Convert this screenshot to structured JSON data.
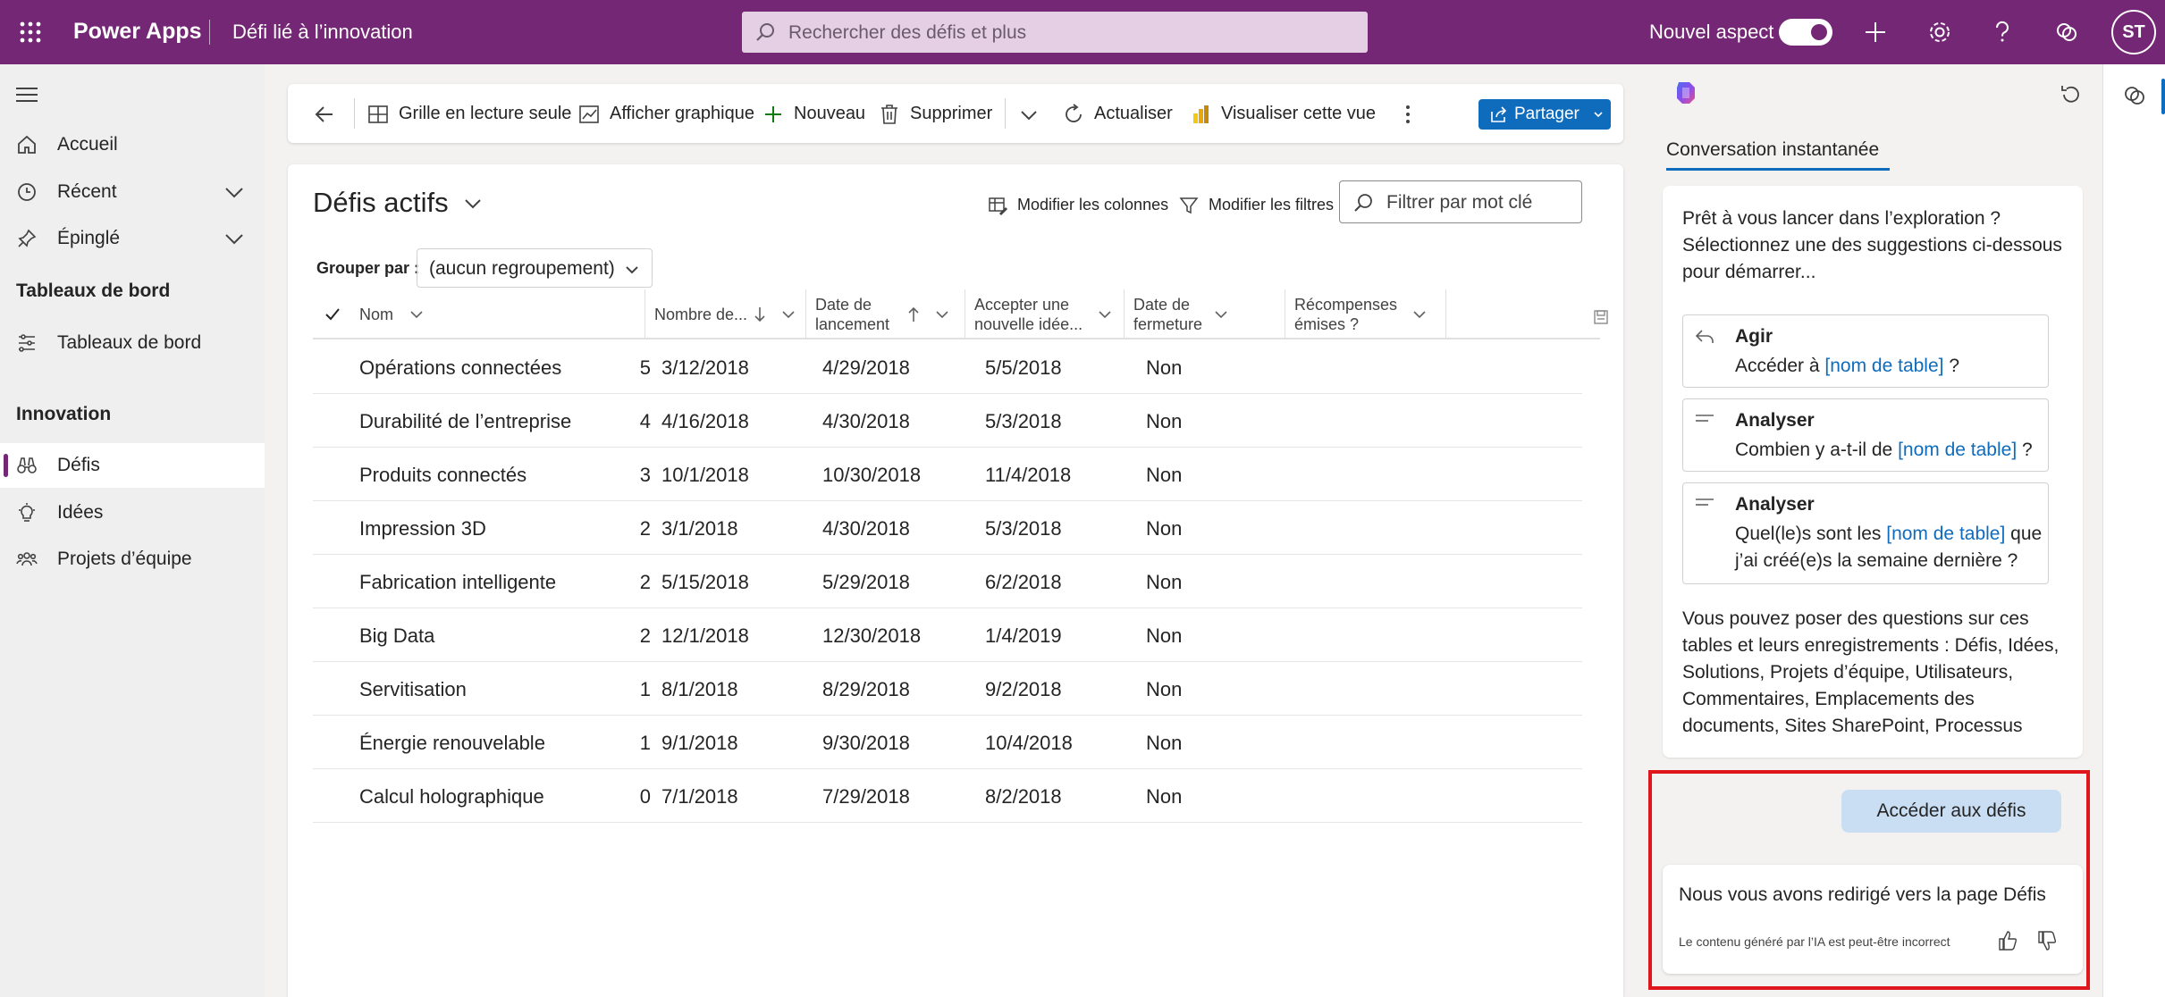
{
  "topbar": {
    "brand": "Power Apps",
    "app_name": "Défi lié à l’innovation",
    "search_placeholder": "Rechercher des défis et plus",
    "nouvel_aspect": "Nouvel aspect",
    "avatar_initials": "ST",
    "color": "#742774"
  },
  "leftnav": {
    "items": [
      {
        "label": "Accueil",
        "icon": "home-icon"
      },
      {
        "label": "Récent",
        "icon": "clock-icon"
      },
      {
        "label": "Épinglé",
        "icon": "pin-icon"
      }
    ],
    "section_dashboards": "Tableaux de bord",
    "dashboards_item": "Tableaux de bord",
    "section_innovation": "Innovation",
    "innovation_items": [
      {
        "label": "Défis",
        "icon": "binoculars-icon",
        "selected": true
      },
      {
        "label": "Idées",
        "icon": "lightbulb-icon"
      },
      {
        "label": "Projets d’équipe",
        "icon": "people-team-icon"
      }
    ]
  },
  "cmdbar": {
    "grille": "Grille en lecture seule",
    "afficher_graphique": "Afficher graphique",
    "nouveau": "Nouveau",
    "supprimer": "Supprimer",
    "actualiser": "Actualiser",
    "visualiser": "Visualiser cette vue",
    "partager": "Partager"
  },
  "grid": {
    "title": "Défis actifs",
    "modifier_colonnes": "Modifier les colonnes",
    "modifier_filtres": "Modifier les filtres",
    "filter_placeholder": "Filtrer par mot clé",
    "group_label": "Grouper par :",
    "group_value": "(aucun regroupement)",
    "columns": {
      "nom": "Nom",
      "nombre": "Nombre de...",
      "lancement_1": "Date de",
      "lancement_2": "lancement",
      "accepter_1": "Accepter une",
      "accepter_2": "nouvelle idée...",
      "fermeture_1": "Date de",
      "fermeture_2": "fermeture",
      "recompenses_1": "Récompenses",
      "recompenses_2": "émises ?"
    },
    "rows": [
      {
        "nom": "Opérations connectées",
        "nombre": "5",
        "lancement": "3/12/2018",
        "accepter": "4/29/2018",
        "fermeture": "5/5/2018",
        "recompenses": "Non"
      },
      {
        "nom": "Durabilité de l’entreprise",
        "nombre": "4",
        "lancement": "4/16/2018",
        "accepter": "4/30/2018",
        "fermeture": "5/3/2018",
        "recompenses": "Non"
      },
      {
        "nom": "Produits connectés",
        "nombre": "3",
        "lancement": "10/1/2018",
        "accepter": "10/30/2018",
        "fermeture": "11/4/2018",
        "recompenses": "Non"
      },
      {
        "nom": "Impression 3D",
        "nombre": "2",
        "lancement": "3/1/2018",
        "accepter": "4/30/2018",
        "fermeture": "5/3/2018",
        "recompenses": "Non"
      },
      {
        "nom": "Fabrication intelligente",
        "nombre": "2",
        "lancement": "5/15/2018",
        "accepter": "5/29/2018",
        "fermeture": "6/2/2018",
        "recompenses": "Non"
      },
      {
        "nom": "Big Data",
        "nombre": "2",
        "lancement": "12/1/2018",
        "accepter": "12/30/2018",
        "fermeture": "1/4/2019",
        "recompenses": "Non"
      },
      {
        "nom": "Servitisation",
        "nombre": "1",
        "lancement": "8/1/2018",
        "accepter": "8/29/2018",
        "fermeture": "9/2/2018",
        "recompenses": "Non"
      },
      {
        "nom": "Énergie renouvelable",
        "nombre": "1",
        "lancement": "9/1/2018",
        "accepter": "9/30/2018",
        "fermeture": "10/4/2018",
        "recompenses": "Non"
      },
      {
        "nom": "Calcul holographique",
        "nombre": "0",
        "lancement": "7/1/2018",
        "accepter": "7/29/2018",
        "fermeture": "8/2/2018",
        "recompenses": "Non"
      }
    ]
  },
  "copilot": {
    "tab": "Conversation instantanée",
    "intro": "Prêt à vous lancer dans l’exploration ? Sélectionnez une des suggestions ci-dessous pour démarrer...",
    "suggestions": [
      {
        "title": "Agir",
        "pre": "Accéder à ",
        "link": "[nom de table]",
        "post": " ?",
        "icon": "undo-arrow-icon"
      },
      {
        "title": "Analyser",
        "pre": "Combien y a-t-il de ",
        "link": "[nom de table]",
        "post": " ?",
        "icon": "text-lines-icon"
      },
      {
        "title": "Analyser",
        "pre": "Quel(le)s sont les ",
        "link": "[nom de table]",
        "post": " que j’ai créé(e)s la semaine dernière ?",
        "icon": "text-lines-icon"
      }
    ],
    "tables_text": "Vous pouvez poser des questions sur ces tables et leurs enregistrements : Défis, Idées, Solutions, Projets d’équipe, Utilisateurs, Commentaires, Emplacements des documents, Sites SharePoint, Processus",
    "user_message": "Accéder aux défis",
    "bot_message": "Nous vous avons redirigé vers la page Défis",
    "disclaimer": "Le contenu généré par l’IA est peut-être incorrect",
    "accent": "#0f6cbd",
    "highlight_color": "#e0161d"
  }
}
